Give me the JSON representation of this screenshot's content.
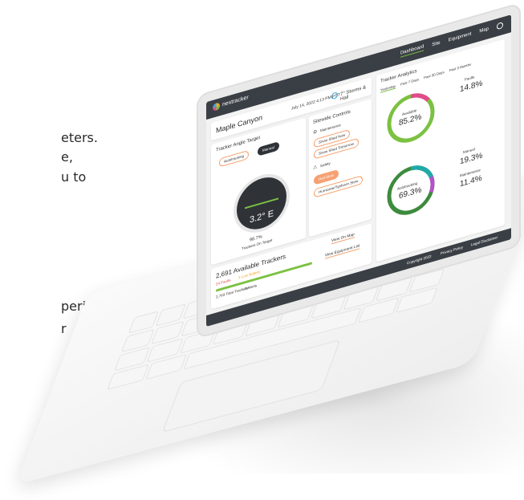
{
  "background_text": [
    "eters.",
    "e,",
    "u to",
    "period",
    "r"
  ],
  "app": {
    "logo_text": "nextracker",
    "nav": [
      "Dashboard",
      "Site",
      "Equipment",
      "Map"
    ]
  },
  "site": {
    "name": "Maple Canyon",
    "date": "July 14, 2022 4:13 PM PST",
    "weather": "7° Storms & Hail"
  },
  "tracker_angle": {
    "title": "Tracker Angle Target",
    "modes": [
      "Autotracking",
      "Manual"
    ],
    "dial_value": "3.2° E",
    "on_target_value": "98.7%",
    "on_target_label": "Trackers On Target"
  },
  "sitewide": {
    "title": "Sitewide Controls",
    "maintenance_label": "Maintenance",
    "buttons": [
      "Snow Shed Now",
      "Snow Shed Tomorrow"
    ],
    "safety_label": "Safety",
    "safety_buttons": [
      "Hail Stow",
      "Hurricane/Typhoon Stow"
    ]
  },
  "available": {
    "title": "2,691 Available Trackers",
    "faults": "24 Faults",
    "battery": "3 Low Battery",
    "total": "2,763 Total Trackers",
    "alerts": "0 Alerts",
    "links": [
      "View On Map",
      "View Equipment List"
    ]
  },
  "analytics": {
    "title": "Tracker Analytics",
    "tabs": [
      "Yesterday",
      "Past 7 Days",
      "Past 30 Days",
      "Past 3 Months"
    ],
    "donut1": {
      "center_label": "Available",
      "center_value": "85.2%",
      "side_label": "Faults",
      "side_value": "14.8%"
    },
    "donut2": {
      "center_label": "Autotracking",
      "center_value": "69.3%",
      "side1_label": "Manual",
      "side1_value": "19.3%",
      "side2_label": "Maintenance",
      "side2_value": "11.4%"
    },
    "colors": {
      "available": "#7cc142",
      "faults": "#e24b8c",
      "autotracking": "#3d8b3d",
      "manual": "#1fa9a9",
      "maintenance": "#b452c8"
    }
  },
  "footer": {
    "copyright": "Copyright 2022",
    "privacy": "Privacy Policy",
    "legal": "Legal Disclaimer"
  }
}
